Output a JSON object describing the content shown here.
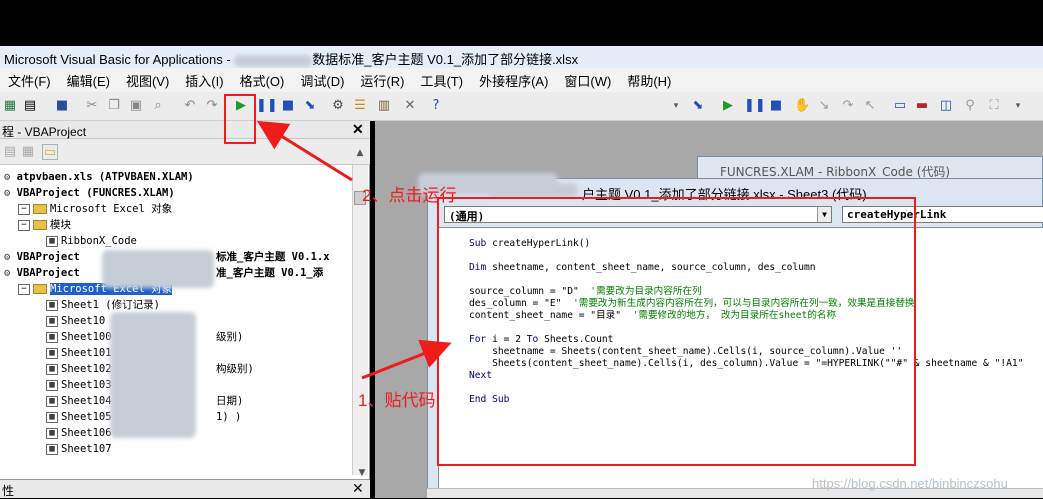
{
  "window": {
    "title_prefix": "Microsoft Visual Basic for Applications - ",
    "title_suffix": "数据标准_客户主题 V0.1_添加了部分链接.xlsx"
  },
  "menu": [
    "文件(F)",
    "编辑(E)",
    "视图(V)",
    "插入(I)",
    "格式(O)",
    "调试(D)",
    "运行(R)",
    "工具(T)",
    "外接程序(A)",
    "窗口(W)",
    "帮助(H)"
  ],
  "toolbar": {
    "run_icon": "play-icon",
    "pause_icon": "pause-icon",
    "stop_icon": "stop-icon",
    "help_icon": "help-icon"
  },
  "project": {
    "title": "程 - VBAProject",
    "tree": [
      {
        "label": "atpvbaen.xls (ATPVBAEN.XLAM)",
        "bold": true,
        "indent": 0
      },
      {
        "label": "VBAProject (FUNCRES.XLAM)",
        "bold": true,
        "indent": 0
      },
      {
        "label": "Microsoft Excel 对象",
        "bold": false,
        "indent": 1,
        "folder": true
      },
      {
        "label": "模块",
        "bold": false,
        "indent": 1,
        "folder": true
      },
      {
        "label": "RibbonX_Code",
        "bold": false,
        "indent": 3
      },
      {
        "label": "VBAProject",
        "bold": true,
        "indent": 0,
        "tail": "标准_客户主题 V0.1.x"
      },
      {
        "label": "VBAProject",
        "bold": true,
        "indent": 0,
        "tail": "准_客户主题 V0.1_添"
      },
      {
        "label": "Microsoft Excel 对象",
        "bold": false,
        "indent": 1,
        "folder": true,
        "selected": true
      },
      {
        "label": "Sheet1 (修订记录)",
        "bold": false,
        "indent": 3
      },
      {
        "label": "Sheet10",
        "bold": false,
        "indent": 3
      },
      {
        "label": "Sheet100",
        "bold": false,
        "indent": 3,
        "tail": "级别)"
      },
      {
        "label": "Sheet101",
        "bold": false,
        "indent": 3
      },
      {
        "label": "Sheet102",
        "bold": false,
        "indent": 3,
        "tail": "构级别)"
      },
      {
        "label": "Sheet103",
        "bold": false,
        "indent": 3
      },
      {
        "label": "Sheet104",
        "bold": false,
        "indent": 3,
        "tail": "日期)"
      },
      {
        "label": "Sheet105",
        "bold": false,
        "indent": 3,
        "tail": "1) )"
      },
      {
        "label": "Sheet106",
        "bold": false,
        "indent": 3
      },
      {
        "label": "Sheet107",
        "bold": false,
        "indent": 3
      }
    ],
    "props_title": "性"
  },
  "back_window": {
    "title": "FUNCRES.XLAM - RibbonX_Code (代码)"
  },
  "code_window": {
    "title": "户主题 V0.1_添加了部分链接.xlsx - Sheet3 (代码)",
    "object_combo": "(通用)",
    "proc_combo": "createHyperLink",
    "lines": [
      {
        "segments": [
          [
            "kw",
            "Sub"
          ],
          [
            "",
            " createHyperLink()"
          ]
        ]
      },
      {
        "segments": [
          [
            "",
            ""
          ]
        ]
      },
      {
        "segments": [
          [
            "kw",
            "Dim"
          ],
          [
            "",
            " sheetname, content_sheet_name, source_column, des_column"
          ]
        ]
      },
      {
        "segments": [
          [
            "",
            ""
          ]
        ]
      },
      {
        "segments": [
          [
            "",
            "source_column = \"D\"  "
          ],
          [
            "cm",
            "'需要改为目录内容所在列"
          ]
        ]
      },
      {
        "segments": [
          [
            "",
            "des_column = \"E\"  "
          ],
          [
            "cm",
            "'需要改为新生成内容内容所在列，可以与目录内容所在列一致，效果是直接替换"
          ]
        ]
      },
      {
        "segments": [
          [
            "",
            "content_sheet_name = \"目录\"  "
          ],
          [
            "cm",
            "'需要修改的地方， 改为目录所在sheet的名称"
          ]
        ]
      },
      {
        "segments": [
          [
            "",
            ""
          ]
        ]
      },
      {
        "segments": [
          [
            "kw",
            "For"
          ],
          [
            "",
            " i = 2 "
          ],
          [
            "kw",
            "To"
          ],
          [
            "",
            " Sheets.Count"
          ]
        ]
      },
      {
        "segments": [
          [
            "",
            "    sheetname = Sheets(content_sheet_name).Cells(i, source_column).Value ''"
          ]
        ]
      },
      {
        "segments": [
          [
            "",
            "    Sheets(content_sheet_name).Cells(i, des_column).Value = \"=HYPERLINK(\"\"#\" & sheetname & \"!A1\""
          ]
        ]
      },
      {
        "segments": [
          [
            "kw",
            "Next"
          ]
        ]
      },
      {
        "segments": [
          [
            "",
            ""
          ]
        ]
      },
      {
        "segments": [
          [
            "kw",
            "End Sub"
          ]
        ]
      }
    ]
  },
  "annotations": {
    "step2": "2、点击运行",
    "step1": "1、贴代码"
  },
  "watermark": "https://blog.csdn.net/binbinczsohu",
  "colors": {
    "annotation": "#f01b1b",
    "comment": "#007f00",
    "keyword": "#00007f"
  }
}
